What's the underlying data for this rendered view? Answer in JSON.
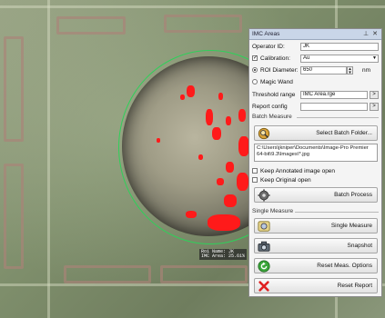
{
  "panel": {
    "title": "IMC Areas",
    "pin_icon": "pin-icon",
    "close_icon": "close-icon",
    "operator_label": "Operator ID:",
    "operator_value": "JK",
    "calibration_label": "Calibration:",
    "calibration_checked": true,
    "calibration_value": "Au",
    "roi_diameter_label": "ROI Diameter:",
    "roi_diameter_value": "650",
    "roi_unit": "nm",
    "magic_wand_label": "Magic Wand",
    "threshold_label": "Threshold range",
    "threshold_value": "IMC Area.rge",
    "report_config_label": "Report config",
    "report_config_value": "",
    "browse_label": ">"
  },
  "batch": {
    "group_title": "Batch Measure",
    "select_folder_label": "Select Batch Folder...",
    "path_line1": "C:\\Users\\jkniper\\Documents\\Image-Pro Premier",
    "path_line2": "64-bit\\9.3\\Images\\*.jpg",
    "keep_annotated_label": "Keep Annotated image open",
    "keep_original_label": "Keep Original open",
    "batch_process_label": "Batch Process"
  },
  "single": {
    "group_title": "Single Measure",
    "single_measure_label": "Single Measure",
    "snapshot_label": "Snapshot",
    "reset_options_label": "Reset Meas. Options",
    "reset_report_label": "Reset Report"
  },
  "image": {
    "roi_label_line1": "Roi Name: JK",
    "roi_label_line2": "IMC Area: 25.61%"
  },
  "colors": {
    "roi_circle": "#2fd05a",
    "detected_area": "#ff1a1a",
    "panel_title_bar": "#c9d6e8"
  }
}
